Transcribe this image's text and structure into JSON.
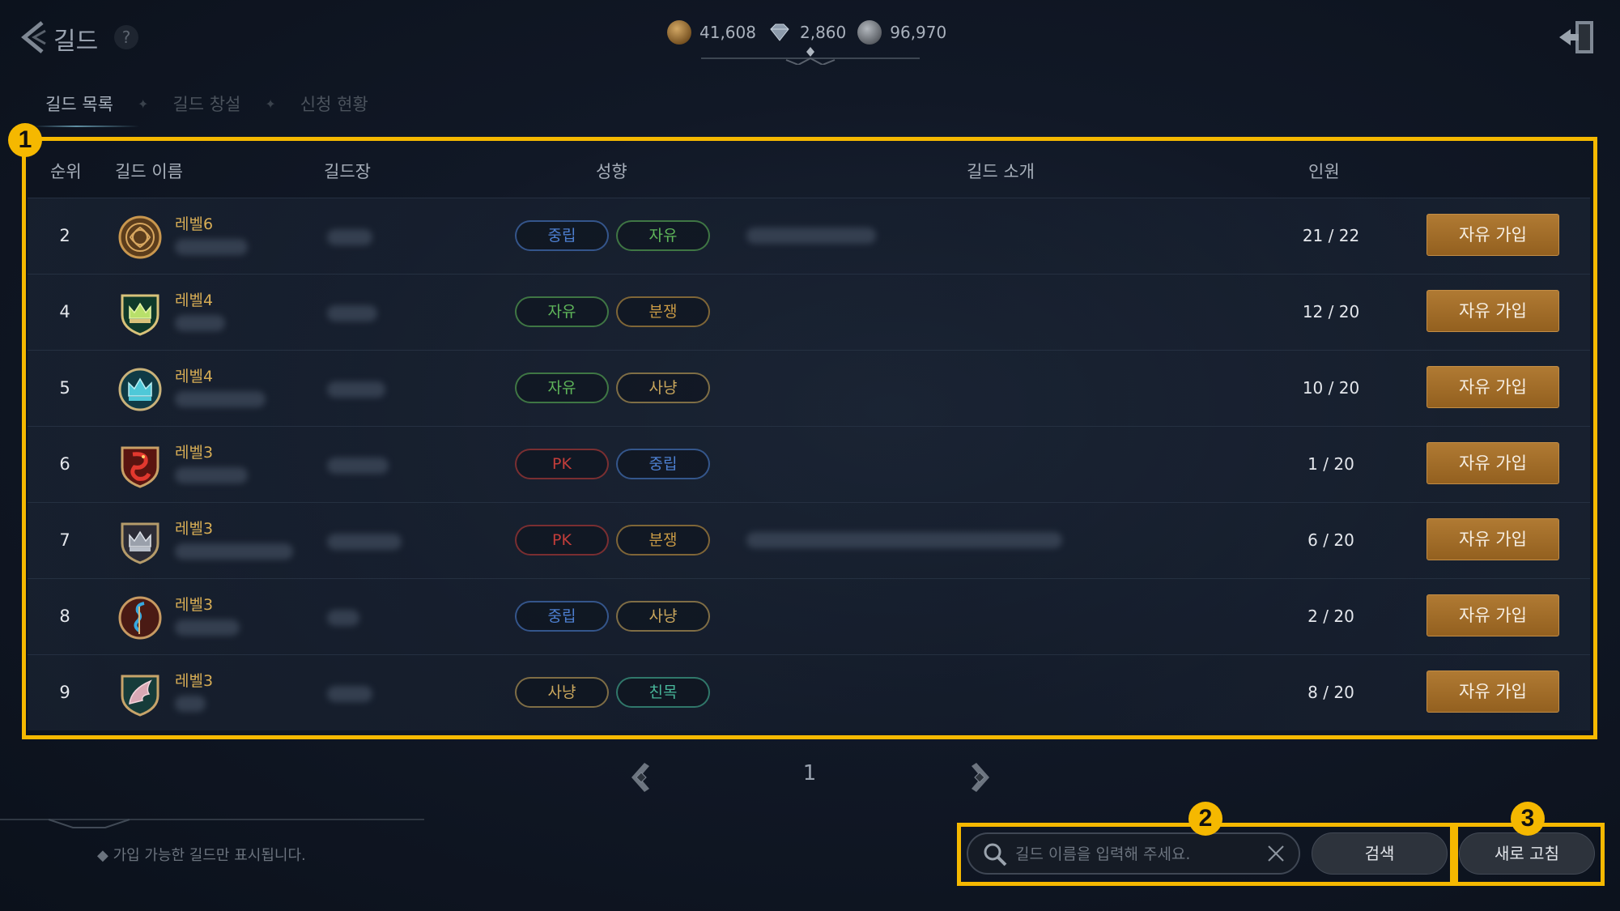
{
  "header": {
    "title": "길드",
    "help_label": "?",
    "currencies": [
      {
        "icon": "gold-coin-icon",
        "value": "41,608"
      },
      {
        "icon": "diamond-icon",
        "value": "2,860"
      },
      {
        "icon": "silver-coin-icon",
        "value": "96,970"
      }
    ]
  },
  "tabs": [
    {
      "label": "길드 목록",
      "active": true
    },
    {
      "label": "길드 창설",
      "active": false
    },
    {
      "label": "신청 현황",
      "active": false
    }
  ],
  "table": {
    "columns": {
      "rank": "순위",
      "name": "길드 이름",
      "leader": "길드장",
      "tendency": "성향",
      "intro": "길드 소개",
      "members": "인원"
    },
    "rows": [
      {
        "rank": "2",
        "level": "레벨6",
        "emblem": "knot-emblem-icon",
        "tags": [
          "중립",
          "자유"
        ],
        "members": "21 / 22",
        "join": "자유 가입"
      },
      {
        "rank": "4",
        "level": "레벨4",
        "emblem": "crown-shield-emblem-icon",
        "tags": [
          "자유",
          "분쟁"
        ],
        "members": "12 / 20",
        "join": "자유 가입"
      },
      {
        "rank": "5",
        "level": "레벨4",
        "emblem": "crown-emblem-icon",
        "tags": [
          "자유",
          "사냥"
        ],
        "members": "10 / 20",
        "join": "자유 가입"
      },
      {
        "rank": "6",
        "level": "레벨3",
        "emblem": "dragon-shield-emblem-icon",
        "tags": [
          "PK",
          "중립"
        ],
        "members": "1 / 20",
        "join": "자유 가입"
      },
      {
        "rank": "7",
        "level": "레벨3",
        "emblem": "crown-shield-emblem-icon",
        "tags": [
          "PK",
          "분쟁"
        ],
        "members": "6 / 20",
        "join": "자유 가입"
      },
      {
        "rank": "8",
        "level": "레벨3",
        "emblem": "serpent-emblem-icon",
        "tags": [
          "중립",
          "사냥"
        ],
        "members": "2 / 20",
        "join": "자유 가입"
      },
      {
        "rank": "9",
        "level": "레벨3",
        "emblem": "wing-shield-emblem-icon",
        "tags": [
          "사냥",
          "친목"
        ],
        "members": "8 / 20",
        "join": "자유 가입"
      }
    ]
  },
  "tag_colors": {
    "중립": "#4d7fd0",
    "자유": "#5fb65a",
    "분쟁": "#c99a45",
    "사냥": "#c9a65c",
    "PK": "#c23d3a",
    "친목": "#48b79a"
  },
  "pagination": {
    "page": "1"
  },
  "footer": {
    "note": "◆ 가입 가능한 길드만 표시됩니다.",
    "search_placeholder": "길드 이름을 입력해 주세요.",
    "search_button": "검색",
    "refresh_button": "새로 고침"
  },
  "annotations": [
    "1",
    "2",
    "3"
  ],
  "highlight_color": "#f5b800"
}
